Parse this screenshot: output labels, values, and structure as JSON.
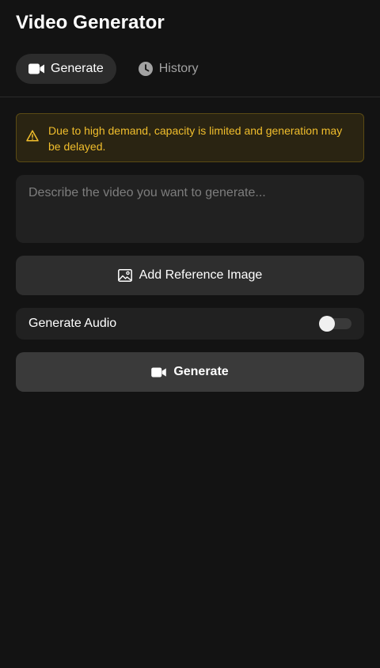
{
  "header": {
    "title": "Video Generator"
  },
  "tabs": [
    {
      "label": "Generate",
      "icon": "video-camera-icon",
      "active": true
    },
    {
      "label": "History",
      "icon": "clock-icon",
      "active": false
    }
  ],
  "notice": {
    "icon": "warning-icon",
    "text": "Due to high demand, capacity is limited and generation may be delayed."
  },
  "prompt": {
    "placeholder": "Describe the video you want to generate...",
    "value": ""
  },
  "reference": {
    "icon": "image-icon",
    "label": "Add Reference Image"
  },
  "audio": {
    "label": "Generate Audio",
    "enabled": false
  },
  "generate": {
    "icon": "video-camera-icon",
    "label": "Generate"
  },
  "colors": {
    "background": "#131313",
    "surface": "#212121",
    "active_tab": "#2c2c2c",
    "warning_text": "#f1be2c",
    "warning_bg": "#2a2412",
    "warning_border": "#5a4a14",
    "primary_button": "#3a3a3a"
  }
}
